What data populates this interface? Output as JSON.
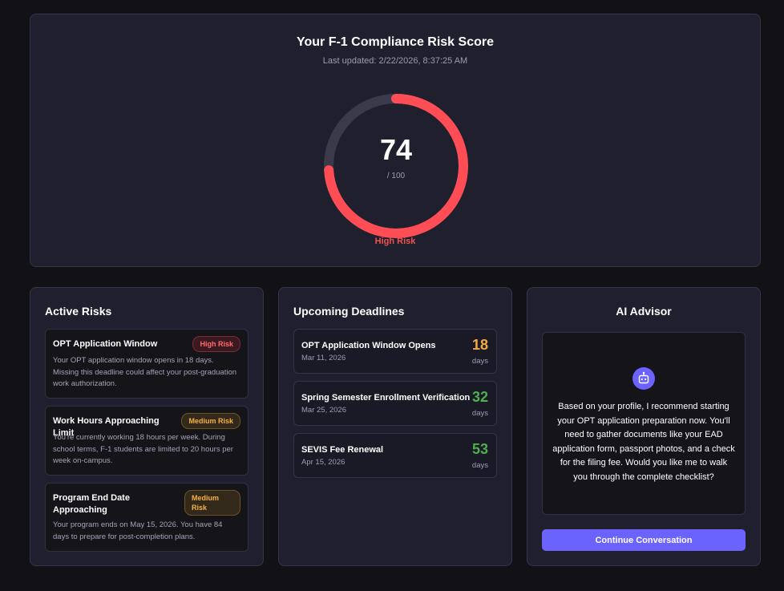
{
  "score": {
    "title": "Your F-1 Compliance Risk Score",
    "last_updated": "Last updated: 2/22/2026, 8:37:25 AM",
    "value": "74",
    "max": "/ 100",
    "value_fraction": 0.74,
    "level": "High Risk",
    "gauge_color": "#ff4d55",
    "track_color": "#3a3a4a"
  },
  "risks": {
    "heading": "Active Risks",
    "items": [
      {
        "title": "OPT Application Window",
        "badge": "High Risk",
        "description": "Your OPT application window opens in 18 days. Missing this deadline could affect your post-graduation work authorization."
      },
      {
        "title": "Work Hours Approaching Limit",
        "badge": "Medium Risk",
        "description": "You're currently working 18 hours per week. During school terms, F-1 students are limited to 20 hours per week on-campus."
      },
      {
        "title": "Program End Date Approaching",
        "badge": "Medium Risk",
        "description": "Your program ends on May 15, 2026. You have 84 days to prepare for post-completion plans."
      }
    ]
  },
  "deadlines": {
    "heading": "Upcoming Deadlines",
    "items": [
      {
        "title": "OPT Application Window Opens",
        "date": "Mar 11, 2026",
        "days": "18",
        "unit": "days",
        "color": "#f5a742"
      },
      {
        "title": "Spring Semester Enrollment Verification",
        "date": "Mar 25, 2026",
        "days": "32",
        "unit": "days",
        "color": "#4caf50"
      },
      {
        "title": "SEVIS Fee Renewal",
        "date": "Apr 15, 2026",
        "days": "53",
        "unit": "days",
        "color": "#4caf50"
      }
    ]
  },
  "advisor": {
    "heading": "AI Advisor",
    "icon": "robot-icon",
    "message": "Based on your profile, I recommend starting your OPT application preparation now. You'll need to gather documents like your EAD application form, passport photos, and a check for the filing fee. Would you like me to walk you through the complete checklist?",
    "button_label": "Continue Conversation"
  }
}
